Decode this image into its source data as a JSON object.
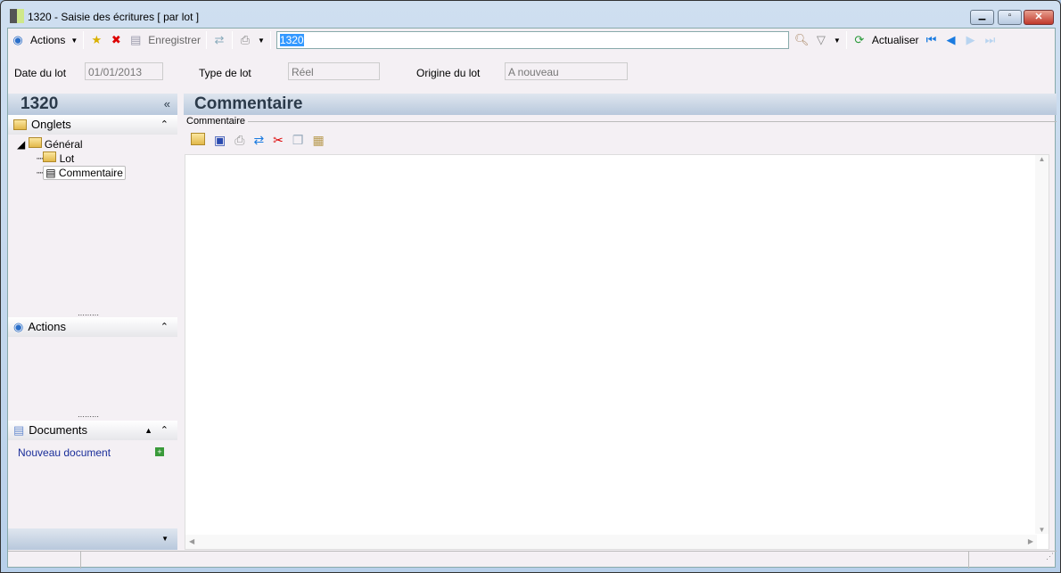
{
  "window": {
    "title": "1320 -  Saisie des écritures [ par lot ]"
  },
  "toolbar": {
    "actions": "Actions",
    "save": "Enregistrer",
    "search_value": "1320",
    "refresh": "Actualiser"
  },
  "fields": {
    "date_label": "Date du lot",
    "date_value": "01/01/2013",
    "type_label": "Type de lot",
    "type_value": "Réel",
    "origin_label": "Origine du lot",
    "origin_value": "A nouveau"
  },
  "sidebar": {
    "title": "1320",
    "tabs_header": "Onglets",
    "tree": {
      "root": "Général",
      "children": [
        "Lot",
        "Commentaire"
      ]
    },
    "actions_header": "Actions",
    "documents_header": "Documents",
    "new_document": "Nouveau document"
  },
  "main": {
    "title": "Commentaire",
    "group_label": "Commentaire"
  }
}
